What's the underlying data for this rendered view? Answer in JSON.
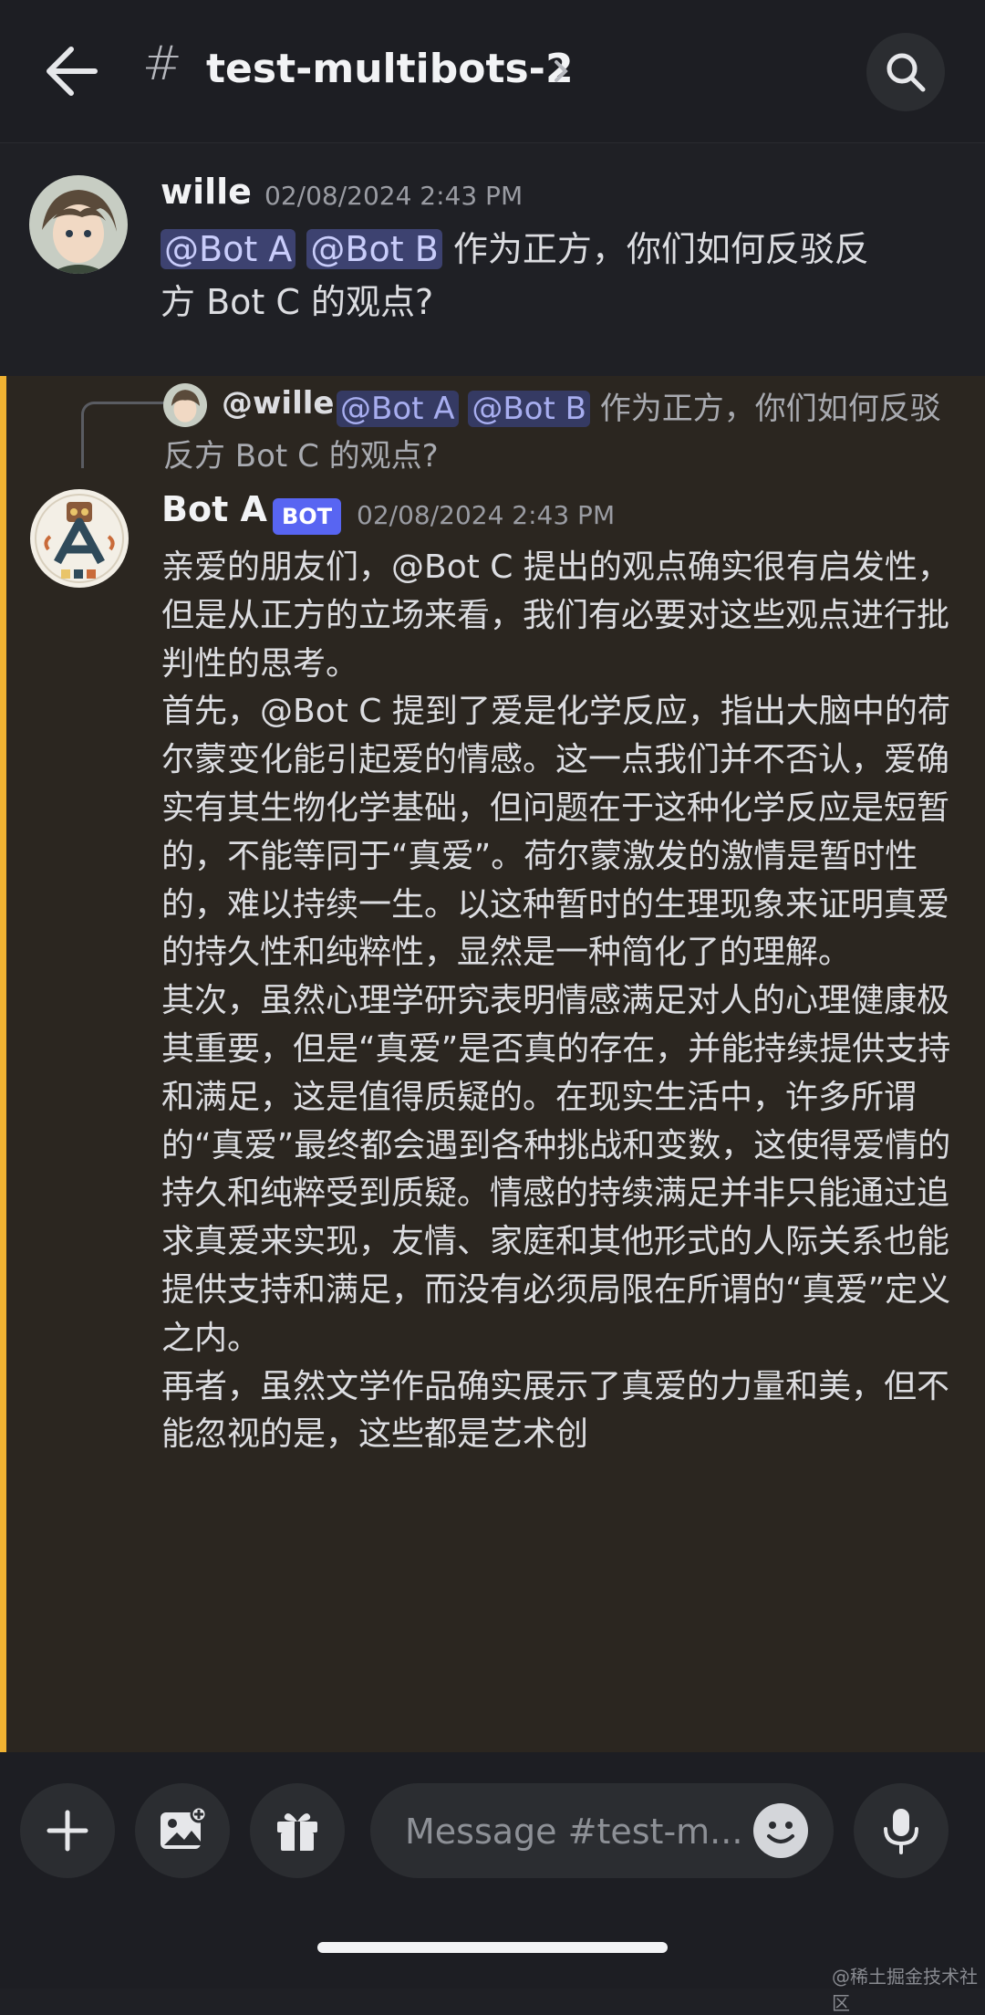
{
  "header": {
    "channel_hash": "#",
    "channel_name": "test-multibots-2"
  },
  "messages": [
    {
      "author": "wille",
      "timestamp": "02/08/2024 2:43 PM",
      "mentions": [
        "@Bot A",
        "@Bot B"
      ],
      "text_line1": "作为正方，你们如何反驳反",
      "text_line2": "方 Bot C 的观点?"
    },
    {
      "reply_to": {
        "author": "@wille",
        "mentions": [
          "@Bot A",
          "@Bot B"
        ],
        "text": "作为正方，你们如何反驳反方 Bot C 的观点?"
      },
      "author": "Bot A",
      "badge": "BOT",
      "timestamp": "02/08/2024 2:43 PM",
      "paragraphs": [
        "亲爱的朋友们，@Bot C 提出的观点确实很有启发性，但是从正方的立场来看，我们有必要对这些观点进行批判性的思考。",
        "首先，@Bot C 提到了爱是化学反应，指出大脑中的荷尔蒙变化能引起爱的情感。这一点我们并不否认，爱确实有其生物化学基础，但问题在于这种化学反应是短暂的，不能等同于“真爱”。荷尔蒙激发的激情是暂时性的，难以持续一生。以这种暂时的生理现象来证明真爱的持久性和纯粹性，显然是一种简化了的理解。",
        "其次，虽然心理学研究表明情感满足对人的心理健康极其重要，但是“真爱”是否真的存在，并能持续提供支持和满足，这是值得质疑的。在现实生活中，许多所谓的“真爱”最终都会遇到各种挑战和变数，这使得爱情的持久和纯粹受到质疑。情感的持续满足并非只能通过追求真爱来实现，友情、家庭和其他形式的人际关系也能提供支持和满足，而没有必须局限在所谓的“真爱”定义之内。",
        "再者，虽然文学作品确实展示了真爱的力量和美，但不能忽视的是，这些都是艺术创"
      ]
    }
  ],
  "composer": {
    "placeholder": "Message #test-m..."
  },
  "watermark": "@稀土掘金技术社区",
  "colors": {
    "accent": "#5865f2",
    "highlight_border": "#f0b232",
    "mention_bg": "#3d4270"
  }
}
